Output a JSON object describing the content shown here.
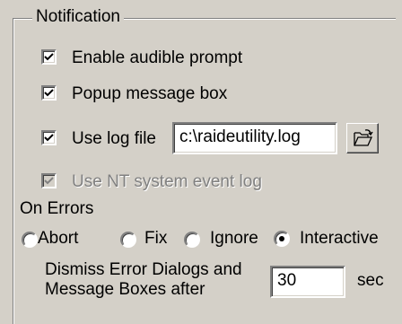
{
  "group": {
    "title": "Notification"
  },
  "options": {
    "audible": {
      "label": "Enable audible prompt",
      "checked": true
    },
    "popup": {
      "label": "Popup message box",
      "checked": true
    },
    "logfile": {
      "label": "Use log file",
      "checked": true,
      "path": "c:\\raideutility.log"
    },
    "ntlog": {
      "label": "Use NT system event log",
      "checked": true,
      "enabled": false
    }
  },
  "errors": {
    "title": "On Errors",
    "choices": [
      {
        "label": "Abort",
        "selected": false
      },
      {
        "label": "Fix",
        "selected": false
      },
      {
        "label": "Ignore",
        "selected": false
      },
      {
        "label": "Interactive",
        "selected": true
      }
    ]
  },
  "dismiss": {
    "label_line1": "Dismiss Error Dialogs and",
    "label_line2": "Message Boxes after",
    "value": "30",
    "unit": "sec"
  },
  "icons": {
    "browse": "open-folder-icon"
  }
}
